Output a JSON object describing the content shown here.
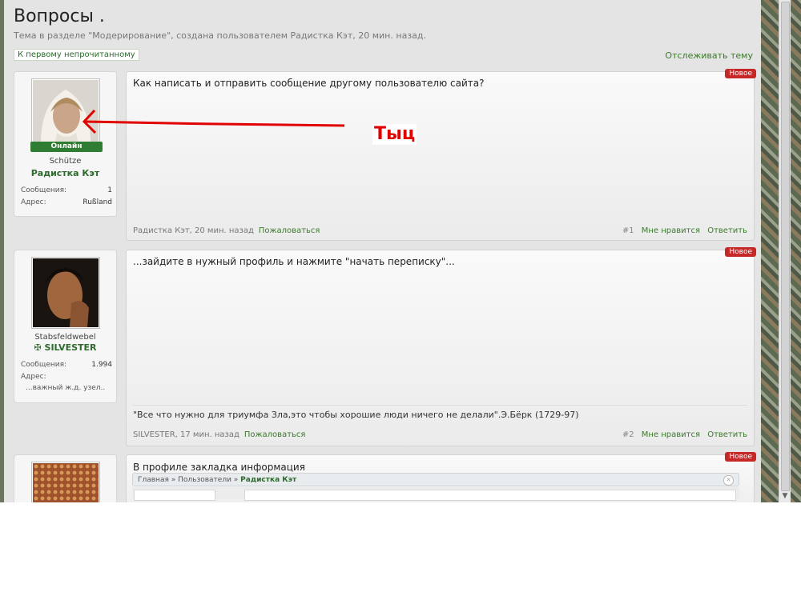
{
  "thread": {
    "title": "Вопросы .",
    "subtitle": "Тема в разделе \"Модерирование\", создана пользователем Радистка Кэт, 20 мин. назад.",
    "first_unread_label": "К первому непрочитанному",
    "watch_label": "Отслеживать тему"
  },
  "posts": [
    {
      "badge": "Новое",
      "user": {
        "online": "Онлайн",
        "rank": "Schütze",
        "name": "Радистка Кэт",
        "stats": [
          {
            "label": "Сообщения:",
            "value": "1"
          },
          {
            "label": "Адрес:",
            "value": "Rußland"
          }
        ]
      },
      "text": "Как написать и отправить сообщение другому пользователю сайта?",
      "meta": "Радистка Кэт, 20 мин. назад",
      "report": "Пожаловаться",
      "number": "#1",
      "like": "Мне нравится",
      "reply": "Ответить"
    },
    {
      "badge": "Новое",
      "user": {
        "rank": "Stabsfeldwebel",
        "name": "✠ SILVESTER",
        "stats": [
          {
            "label": "Сообщения:",
            "value": "1.994"
          },
          {
            "label": "Адрес:",
            "value": "...важный ж.д. узел.."
          }
        ]
      },
      "text": "...зайдите в нужный профиль и нажмите \"начать переписку\"...",
      "signature": "\"Все что нужно для триумфа Зла,это чтобы хорошие люди ничего не делали\".Э.Бёрк (1729-97)",
      "meta": "SILVESTER, 17 мин. назад",
      "report": "Пожаловаться",
      "number": "#2",
      "like": "Мне нравится",
      "reply": "Ответить"
    },
    {
      "badge": "Новое",
      "text": "В профиле закладка информация",
      "embedded_breadcrumb": {
        "home": "Главная",
        "section": "Пользователи",
        "current": "Радистка Кэт"
      }
    }
  ],
  "annotation": {
    "label": "Тыц",
    "color": "#e00000"
  }
}
